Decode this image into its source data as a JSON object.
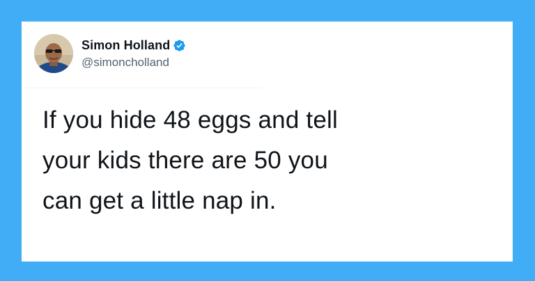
{
  "theme": {
    "background_color": "#41adf7",
    "card_color": "#ffffff",
    "verified_color": "#1d9bf0"
  },
  "user": {
    "display_name": "Simon Holland",
    "handle": "@simoncholland",
    "verified_icon": "verified-badge-icon",
    "avatar": "profile-photo"
  },
  "tweet": {
    "lines": [
      "If you hide 48 eggs and tell",
      "your kids there are 50 you",
      "can get a little nap in."
    ]
  }
}
